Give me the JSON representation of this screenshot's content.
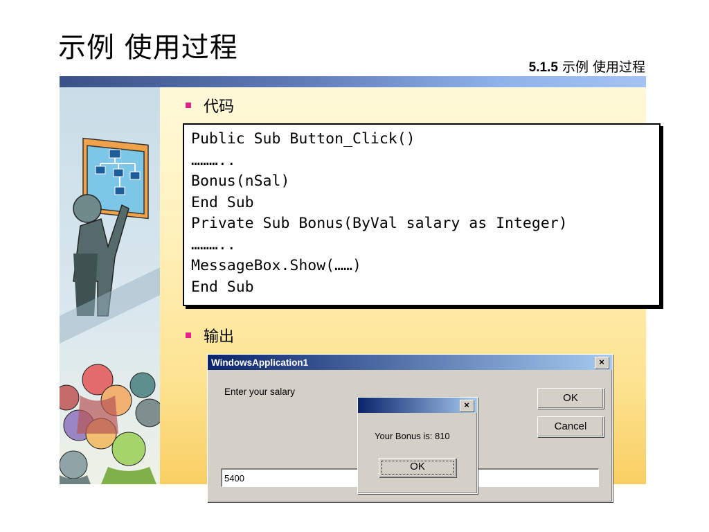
{
  "slide": {
    "title": "示例  使用过程",
    "section_number": "5.1.5",
    "section_title": " 示例  使用过程"
  },
  "bullets": {
    "code_label": "代码",
    "output_label": "输出"
  },
  "code_lines": [
    "Public Sub Button_Click()",
    "………..",
    "Bonus(nSal)",
    "End Sub",
    "Private Sub Bonus(ByVal salary as Integer)",
    "………..",
    "MessageBox.Show(……)",
    "End Sub"
  ],
  "main_dialog": {
    "title": "WindowsApplication1",
    "close_glyph": "×",
    "prompt_label": "Enter your salary",
    "ok_label": "OK",
    "cancel_label": "Cancel",
    "input_value": "5400"
  },
  "message_box": {
    "close_glyph": "×",
    "message": "Your Bonus is: 810",
    "ok_label": "OK"
  },
  "icons": [
    "org-chart-icon",
    "presenter-figure-icon",
    "people-group-icon"
  ],
  "colors": {
    "bullet": "#e0248a",
    "title_bar_start": "#0a246a",
    "title_bar_end": "#a6caf0",
    "dialog_face": "#d4d0c8"
  }
}
